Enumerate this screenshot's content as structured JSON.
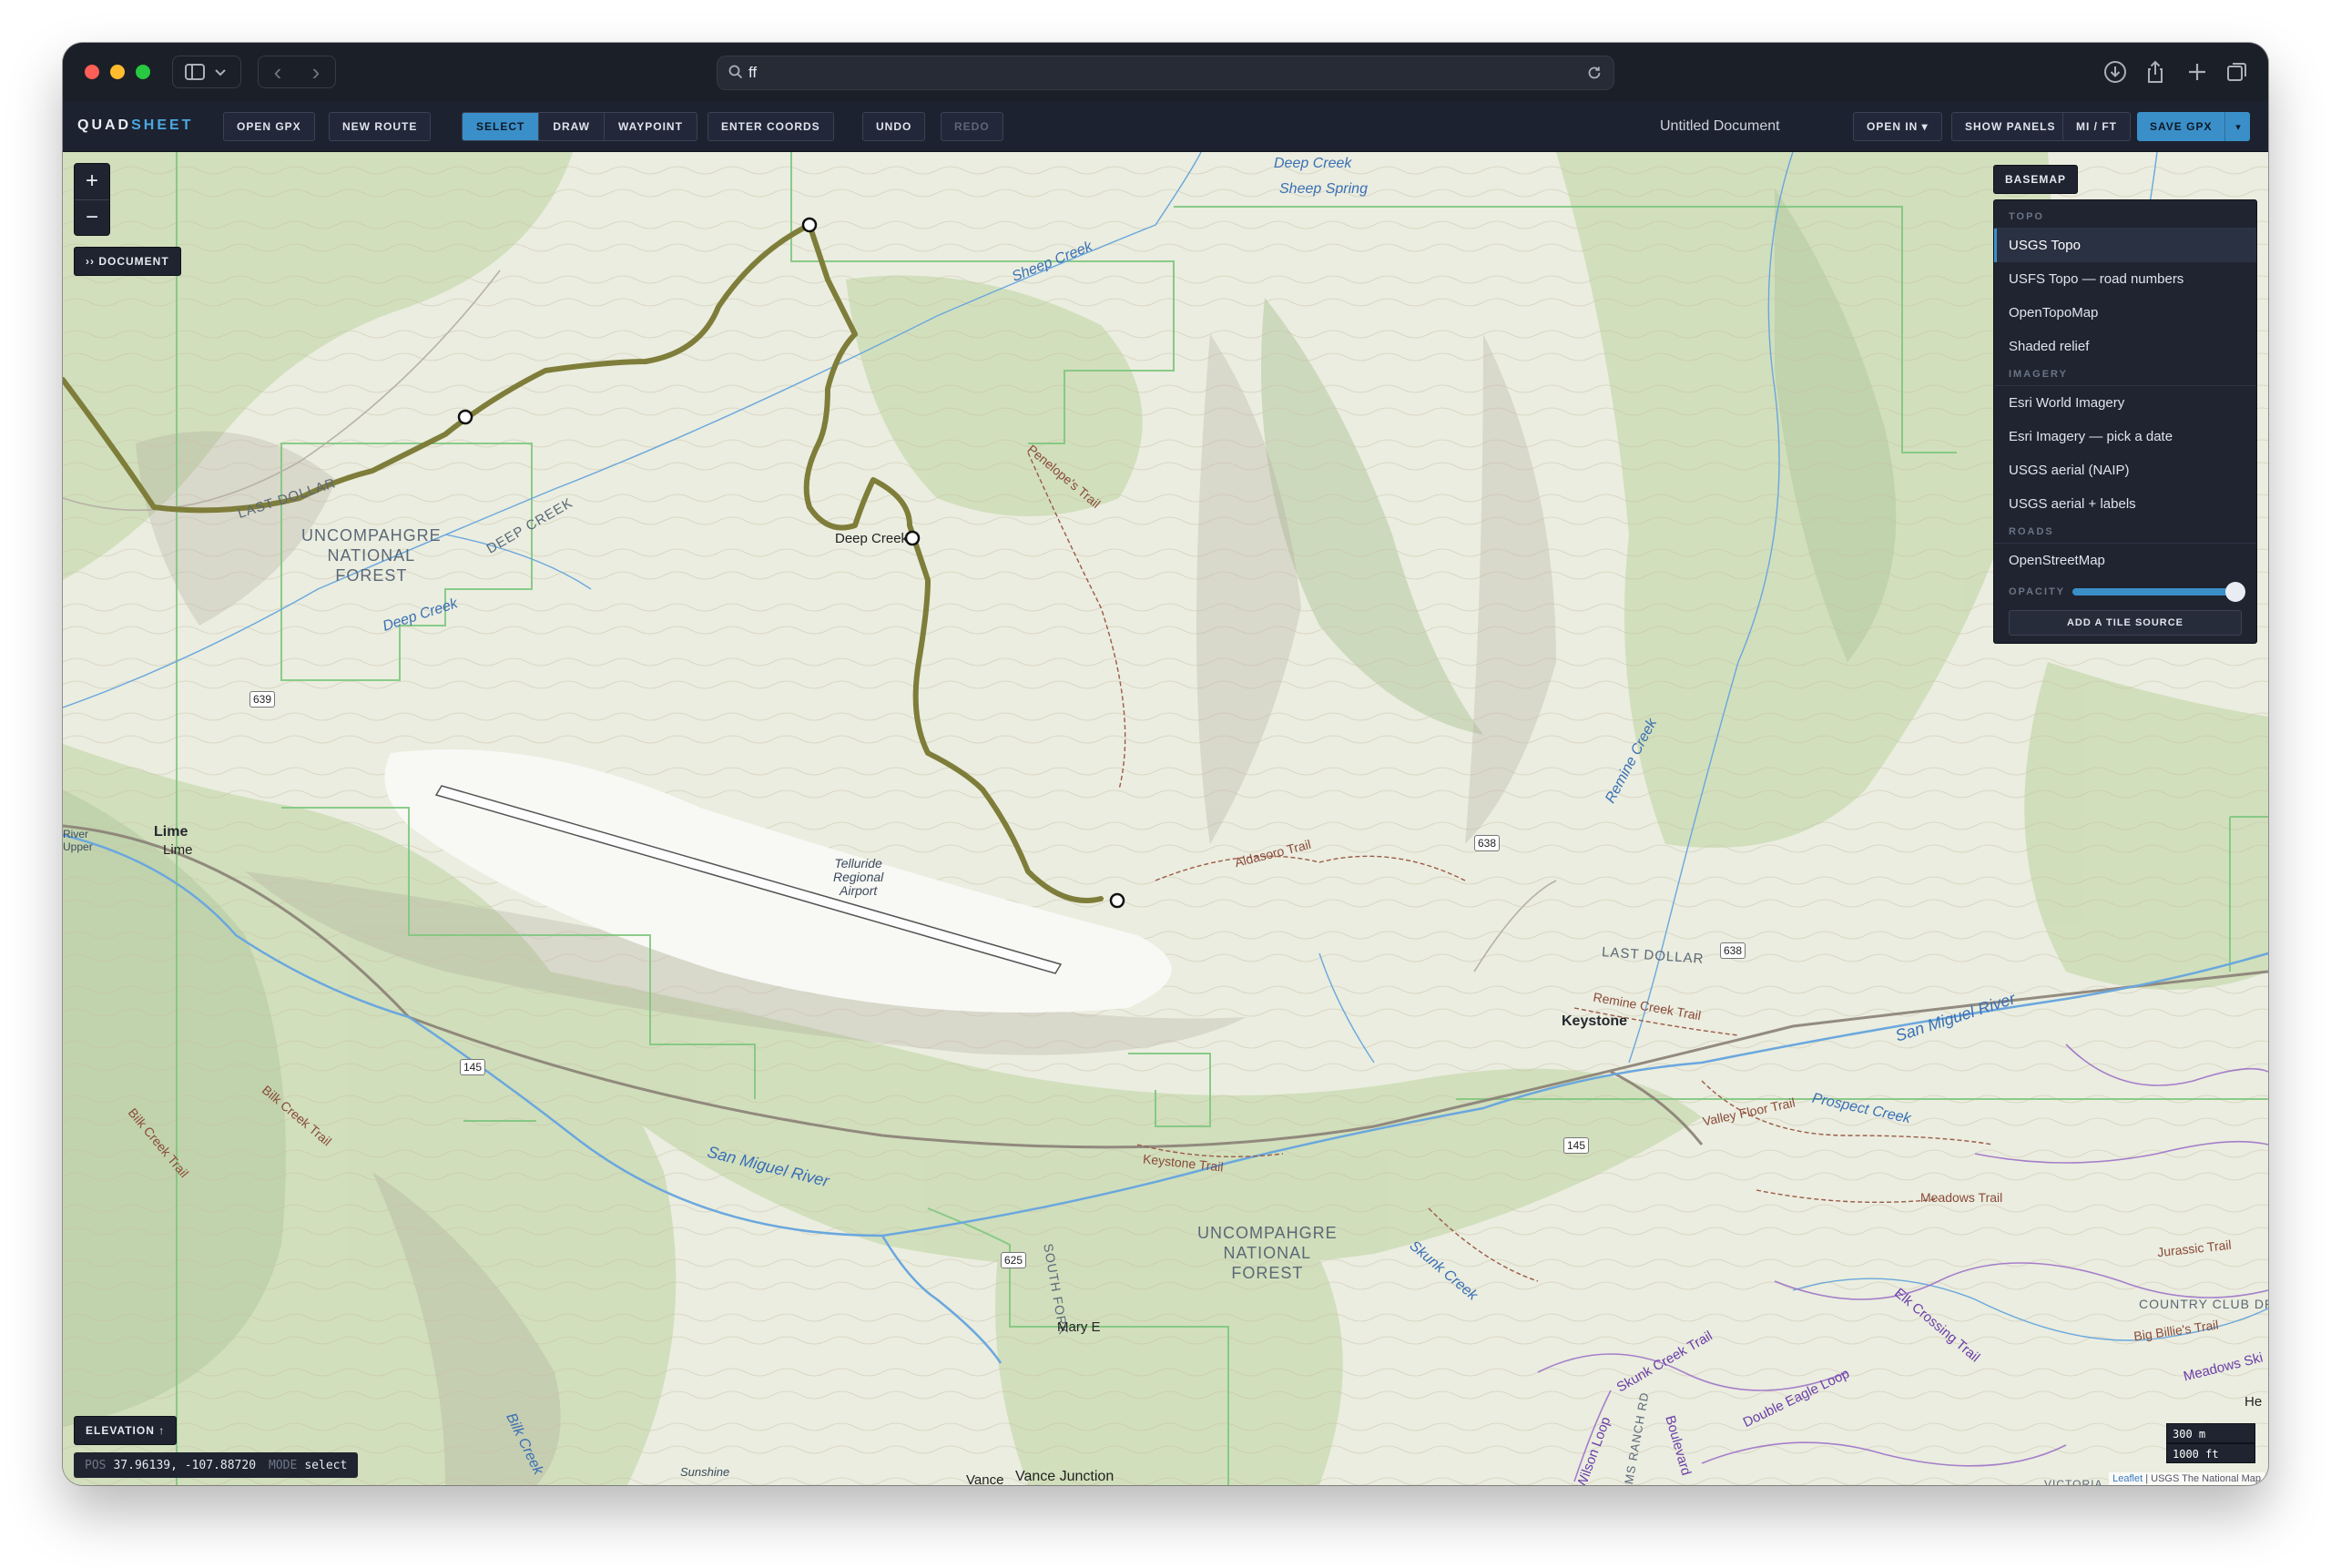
{
  "browser": {
    "url_text": "ff"
  },
  "toolbar": {
    "logo_part1": "QUAD",
    "logo_part2": "SHEET",
    "open_gpx": "OPEN GPX",
    "new_route": "NEW ROUTE",
    "modes": [
      "SELECT",
      "DRAW",
      "WAYPOINT"
    ],
    "active_mode": "SELECT",
    "enter_coords": "ENTER COORDS",
    "undo": "UNDO",
    "redo": "REDO",
    "document_title": "Untitled Document",
    "open_in": "OPEN IN ▾",
    "show_panels": "SHOW PANELS",
    "units": "MI / FT",
    "save_gpx": "SAVE GPX",
    "save_menu_arrow": "▾"
  },
  "map_controls": {
    "zoom_in": "+",
    "zoom_out": "−",
    "document_button": "›› DOCUMENT",
    "elevation_button": "ELEVATION ↑",
    "basemap_button": "BASEMAP"
  },
  "status": {
    "pos_label": "POS",
    "pos_value": "37.96139, -107.88720",
    "mode_label": "MODE",
    "mode_value": "select"
  },
  "basemap_menu": {
    "groups": [
      {
        "heading": "TOPO",
        "items": [
          "USGS Topo",
          "USFS Topo — road numbers",
          "OpenTopoMap",
          "Shaded relief"
        ]
      },
      {
        "heading": "IMAGERY",
        "items": [
          "Esri World Imagery",
          "Esri Imagery — pick a date",
          "USGS aerial (NAIP)",
          "USGS aerial + labels"
        ]
      },
      {
        "heading": "ROADS",
        "items": [
          "OpenStreetMap"
        ]
      }
    ],
    "selected": "USGS Topo",
    "opacity_label": "OPACITY",
    "opacity_value": 1.0,
    "add_source": "ADD A TILE SOURCE"
  },
  "scale": {
    "metric": "300 m",
    "imperial": "1000 ft"
  },
  "attribution": {
    "leaflet": "Leaflet",
    "rest": " | USGS The National Map"
  },
  "map_labels": {
    "deep_creek_top": "Deep Creek",
    "sheep_spring": "Sheep Spring",
    "sheep_creek": "Sheep Creek",
    "last_dollar_1": "LAST DOLLAR",
    "deep_creek_road": "DEEP CREEK",
    "national_forest_1": "UNCOMPAHGRE\nNATIONAL\nFOREST",
    "deep_creek_mid": "Deep Creek",
    "deep_creek_label": "Deep Creek",
    "penelopes_trail": "Penelope's Trail",
    "airport": "Telluride\nRegional\nAirport",
    "lime": "Lime",
    "lime2": "Lime",
    "river_upper": "River\nUpper",
    "aldasoro_trail": "Aldasoro Trail",
    "remine_creek": "Remine Creek",
    "last_dollar_2": "LAST DOLLAR",
    "remine_creek_trail": "Remine Creek Trail",
    "keystone": "Keystone",
    "san_miguel_river_e": "San Miguel River",
    "prospect_creek": "Prospect Creek",
    "valley_floor_trail": "Valley Floor Trail",
    "san_miguel_river_w": "San Miguel River",
    "keystone_trail": "Keystone Trail",
    "bilk_creek_trail": "Bilk Creek Trail",
    "bilk_creek_trail2": "Bilk Creek Trail",
    "national_forest_2": "UNCOMPAHGRE\nNATIONAL\nFOREST",
    "south_fork": "SOUTH FORK",
    "mary_e": "Mary E",
    "skunk_creek": "Skunk Creek",
    "meadows_trail": "Meadows Trail",
    "jurassic_trail": "Jurassic Trail",
    "country_club": "COUNTRY CLUB DR",
    "big_billies": "Big Billie's Trail",
    "meadows_ski": "Meadows Ski",
    "elk_crossing": "Elk Crossing Trail",
    "skunk_creek_trail": "Skunk Creek Trail",
    "double_eagle": "Double Eagle Loop",
    "wilson_loop": "Wilson Loop",
    "adams_ranch": "ADAMS RANCH RD",
    "boulevard": "Boulevard",
    "bilk_creek": "Bilk Creek",
    "sunshine": "Sunshine",
    "vance_junction": "Vance Junction",
    "vance": "Vance",
    "he": "He",
    "victoria": "VICTORIA"
  },
  "shields": [
    "639",
    "145",
    "625",
    "638",
    "638",
    "145"
  ],
  "colors": {
    "accent": "#3a8fc9",
    "route": "#7e7d3a",
    "water": "#6aa7de",
    "boundary": "#7fc67f"
  }
}
